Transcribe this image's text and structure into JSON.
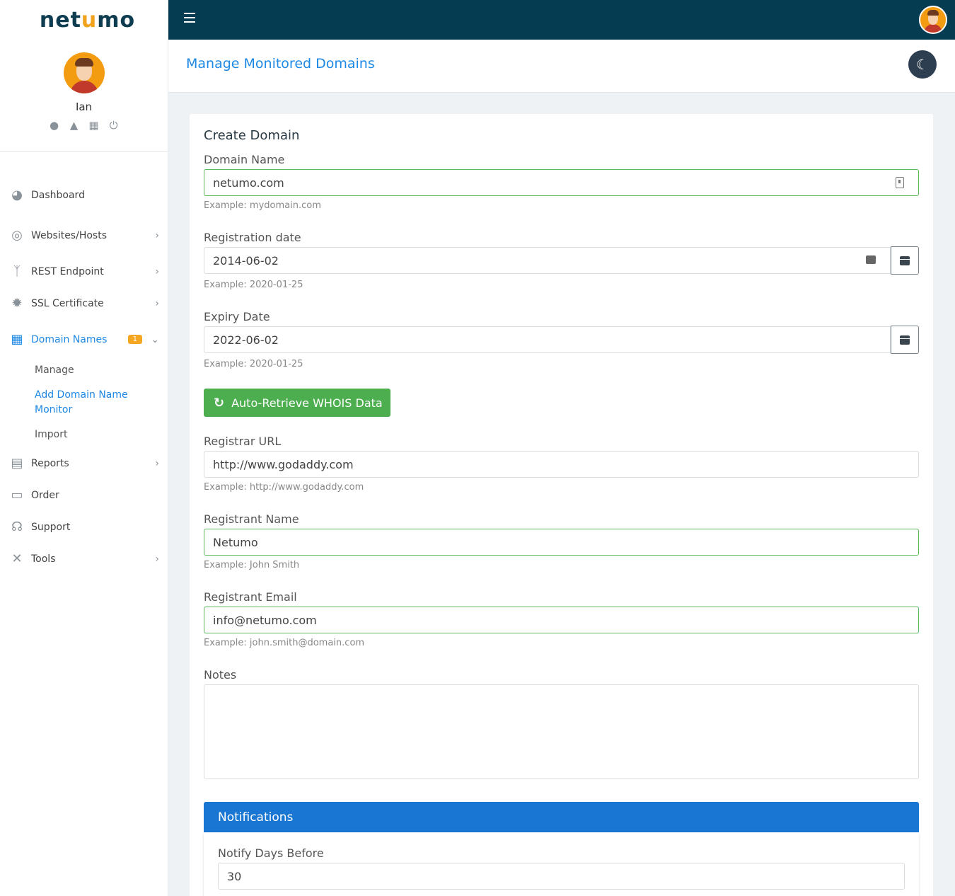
{
  "app": {
    "logo_text_1": "net",
    "logo_text_2": "u",
    "logo_text_3": "mo",
    "accent_color": "#1e88e5",
    "topbar_color": "#063c52"
  },
  "profile": {
    "name": "Ian",
    "icons": [
      "user-icon",
      "bell-icon",
      "sitemap-icon",
      "power-icon"
    ]
  },
  "sidebar": {
    "items": [
      {
        "label": "Dashboard",
        "icon": "dashboard-icon"
      },
      {
        "label": "Websites/Hosts",
        "icon": "globe-icon"
      },
      {
        "label": "REST Endpoint",
        "icon": "branch-icon"
      },
      {
        "label": "SSL Certificate",
        "icon": "certificate-icon"
      },
      {
        "label": "Domain Names",
        "icon": "building-icon",
        "badge": "1"
      },
      {
        "label": "Reports",
        "icon": "file-icon"
      },
      {
        "label": "Order",
        "icon": "wallet-icon"
      },
      {
        "label": "Support",
        "icon": "headset-icon"
      },
      {
        "label": "Tools",
        "icon": "tools-icon"
      }
    ],
    "subitems": [
      {
        "label": "Manage"
      },
      {
        "label": "Add Domain Name Monitor"
      },
      {
        "label": "Import"
      }
    ]
  },
  "page": {
    "title": "Manage Monitored Domains"
  },
  "form": {
    "title": "Create Domain",
    "domain_name": {
      "label": "Domain Name",
      "value": "netumo.com",
      "help": "Example: mydomain.com"
    },
    "registration_date": {
      "label": "Registration date",
      "value": "2014-06-02",
      "help": "Example: 2020-01-25"
    },
    "expiry_date": {
      "label": "Expiry Date",
      "value": "2022-06-02",
      "help": "Example: 2020-01-25"
    },
    "whois_button": "Auto-Retrieve WHOIS Data",
    "registrar_url": {
      "label": "Registrar URL",
      "value": "http://www.godaddy.com",
      "help": "Example: http://www.godaddy.com"
    },
    "registrant_name": {
      "label": "Registrant Name",
      "value": "Netumo",
      "help": "Example: John Smith"
    },
    "registrant_email": {
      "label": "Registrant Email",
      "value": "info@netumo.com",
      "help": "Example: john.smith@domain.com"
    },
    "notes": {
      "label": "Notes",
      "value": ""
    }
  },
  "notifications": {
    "title": "Notifications",
    "notify_days": {
      "label": "Notify Days Before",
      "value": "30"
    }
  }
}
